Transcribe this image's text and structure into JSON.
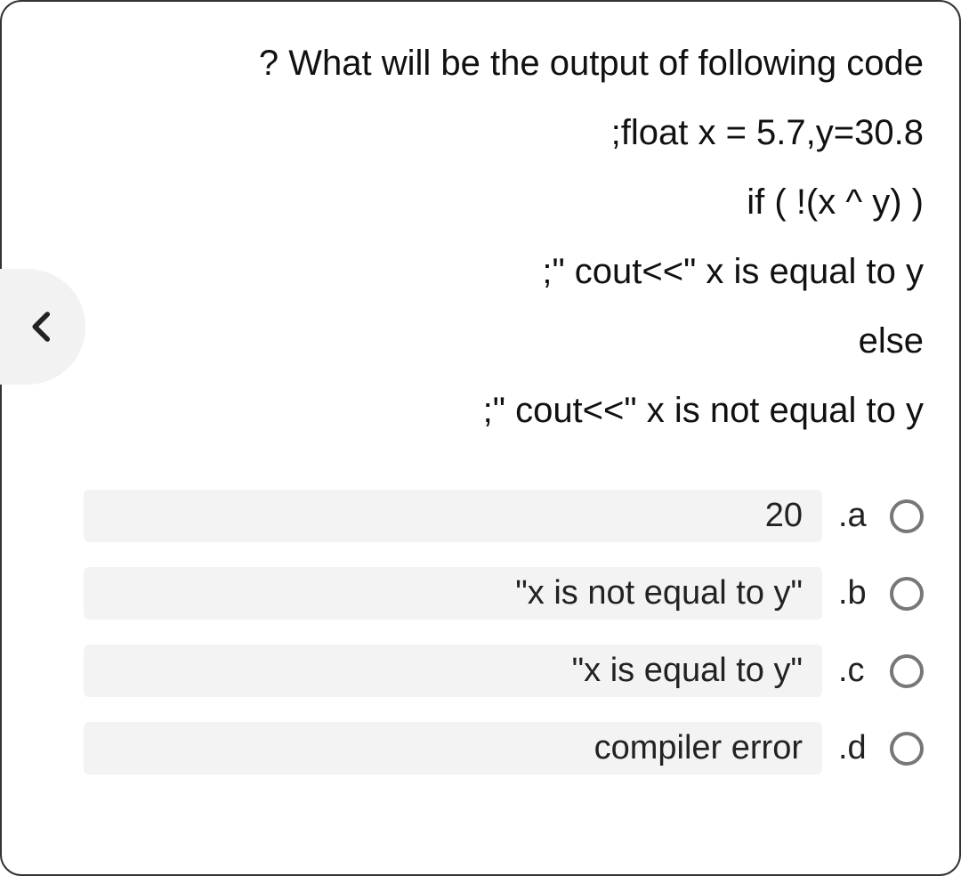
{
  "question": {
    "lines": [
      "? What will be the output of following code",
      ";float x = 5.7,y=30.8",
      "if ( !(x ^ y) )",
      ";\" cout<<\" x is equal to y",
      "else",
      ";\" cout<<\" x is not equal to y"
    ]
  },
  "options": [
    {
      "label": ".a",
      "text": "20"
    },
    {
      "label": ".b",
      "text": "\"x is not equal to y\""
    },
    {
      "label": ".c",
      "text": "\"x is equal to y\""
    },
    {
      "label": ".d",
      "text": "compiler error"
    }
  ]
}
